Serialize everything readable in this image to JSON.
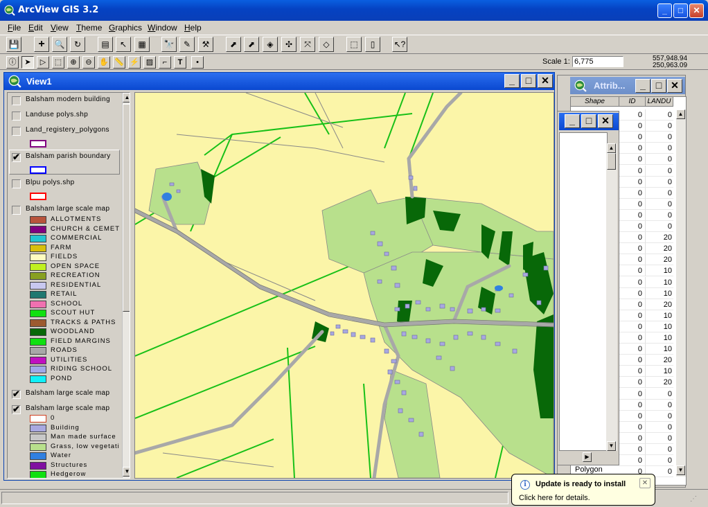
{
  "app": {
    "title": "ArcView GIS 3.2",
    "icon": "arcview-globe-icon"
  },
  "window_controls": {
    "minimize": "_",
    "maximize": "□",
    "close": "✕"
  },
  "menu": [
    "File",
    "Edit",
    "View",
    "Theme",
    "Graphics",
    "Window",
    "Help"
  ],
  "toolbar1_icons": [
    "save-icon",
    "add-theme-icon",
    "theme-properties-icon",
    "edit-legend-icon",
    "open-table-icon",
    "select-feature-icon",
    "clear-selection-icon",
    "query-builder-icon",
    "find-icon",
    "locate-address-icon",
    "hotlink-icon",
    "zoom-full-extent-icon",
    "zoom-to-themes-icon",
    "zoom-to-selected-icon",
    "zoom-previous-icon",
    "select-all-icon",
    "layout-icon",
    "help-icon"
  ],
  "toolbar2_icons": [
    "identify-icon",
    "pointer-icon",
    "vertex-edit-icon",
    "select-tool-icon",
    "zoom-in-icon",
    "zoom-out-icon",
    "pan-icon",
    "measure-icon",
    "hotlink-tool-icon",
    "area-of-interest-icon",
    "label-icon",
    "text-icon",
    "draw-point-icon"
  ],
  "scale": {
    "label": "Scale 1:",
    "value": "6,775"
  },
  "coordinates": {
    "x": "557,948.94",
    "y": "250,963.09"
  },
  "view": {
    "title": "View1"
  },
  "toc": {
    "themes": [
      {
        "name": "Balsham modern building",
        "checked": false
      },
      {
        "name": "Landuse polys.shp",
        "checked": false
      },
      {
        "name": "Land_registery_polygons",
        "checked": false,
        "symbol_outline": "#800080"
      },
      {
        "name": "Balsham parish boundary",
        "checked": true,
        "symbol_outline": "#0000ff"
      },
      {
        "name": "Blpu polys.shp",
        "checked": false,
        "symbol_outline": "#ff0000"
      },
      {
        "name": "Balsham large scale map",
        "checked": false
      }
    ],
    "landuse_legend": [
      {
        "label": "ALLOTMENTS",
        "color": "#b8543c"
      },
      {
        "label": "CHURCH & CEMET",
        "color": "#800080"
      },
      {
        "label": "COMMERCIAL",
        "color": "#22c4d0"
      },
      {
        "label": "FARM",
        "color": "#d8c00c"
      },
      {
        "label": "FIELDS",
        "color": "#fffcc0"
      },
      {
        "label": "OPEN SPACE",
        "color": "#c0f020"
      },
      {
        "label": "RECREATION",
        "color": "#88a020"
      },
      {
        "label": "RESIDENTIAL",
        "color": "#c8c8f0"
      },
      {
        "label": "RETAIL",
        "color": "#207870"
      },
      {
        "label": "SCHOOL",
        "color": "#f070b0"
      },
      {
        "label": "SCOUT HUT",
        "color": "#10e010"
      },
      {
        "label": "TRACKS & PATHS",
        "color": "#9c5a30"
      },
      {
        "label": "WOODLAND",
        "color": "#086808"
      },
      {
        "label": "FIELD MARGINS",
        "color": "#10e010"
      },
      {
        "label": "ROADS",
        "color": "#a8a8a8"
      },
      {
        "label": "UTILITIES",
        "color": "#c010c0"
      },
      {
        "label": "RIDING SCHOOL",
        "color": "#a0a8e8"
      },
      {
        "label": "POND",
        "color": "#10f0f8"
      }
    ],
    "themes_lower": [
      {
        "name": "Balsham large scale map",
        "checked": true
      },
      {
        "name": "Balsham large scale map",
        "checked": true
      }
    ],
    "topo_legend": [
      {
        "label": "0",
        "color": "#ffffff",
        "outline": "#d04020"
      },
      {
        "label": "Building",
        "color": "#a8a8e0"
      },
      {
        "label": "Man made surface",
        "color": "#c8c8c8"
      },
      {
        "label": "Grass, low vegetati",
        "color": "#b8e08c"
      },
      {
        "label": "Water",
        "color": "#3080e0"
      },
      {
        "label": "Structures",
        "color": "#8010a0"
      },
      {
        "label": "Hedgerow",
        "color": "#10e010"
      }
    ]
  },
  "attribute_table": {
    "title": "Attrib...",
    "columns": [
      "Shape",
      "ID",
      "LANDU"
    ],
    "visible_shape": "Polygon",
    "landuse_values": [
      "0",
      "0",
      "0",
      "0",
      "0",
      "0",
      "0",
      "0",
      "0",
      "0",
      "0",
      "20",
      "20",
      "20",
      "10",
      "10",
      "10",
      "20",
      "10",
      "10",
      "10",
      "10",
      "20",
      "10",
      "20",
      "0",
      "0",
      "0",
      "0",
      "0",
      "0",
      "0",
      "0"
    ]
  },
  "notification": {
    "title": "Update is ready to install",
    "text": "Click here for details."
  }
}
